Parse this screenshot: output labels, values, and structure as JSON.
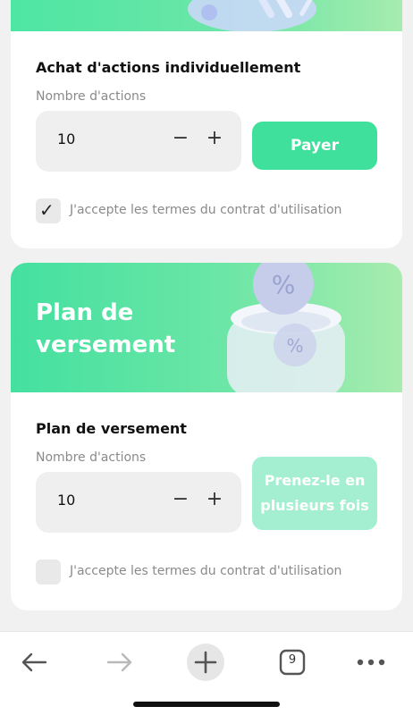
{
  "purchase": {
    "title": "Achat d'actions individuellement",
    "quantity_label": "Nombre d'actions",
    "quantity_value": "10",
    "pay_button": "Payer",
    "terms_label": "J'accepte les termes du contrat d'utilisation",
    "terms_checked": true
  },
  "plan": {
    "hero_line1": "Plan de",
    "hero_line2": "versement",
    "title": "Plan de versement",
    "quantity_label": "Nombre d'actions",
    "quantity_value": "10",
    "split_button_line1": "Prenez-le en",
    "split_button_line2": "plusieurs fois",
    "terms_label": "J'accepte les termes du contrat d'utilisation",
    "terms_checked": false
  },
  "stepper": {
    "minus": "−",
    "plus": "+"
  },
  "browser_bar": {
    "tab_count": "9",
    "icons": [
      "back-arrow-icon",
      "forward-arrow-icon",
      "new-tab-plus-icon",
      "tabs-counter-icon",
      "more-dots-icon"
    ]
  },
  "colors": {
    "accent": "#3fe09b",
    "accent_disabled": "#a4efd1",
    "banner_start": "#44e0a0",
    "banner_end": "#a8ecae"
  }
}
